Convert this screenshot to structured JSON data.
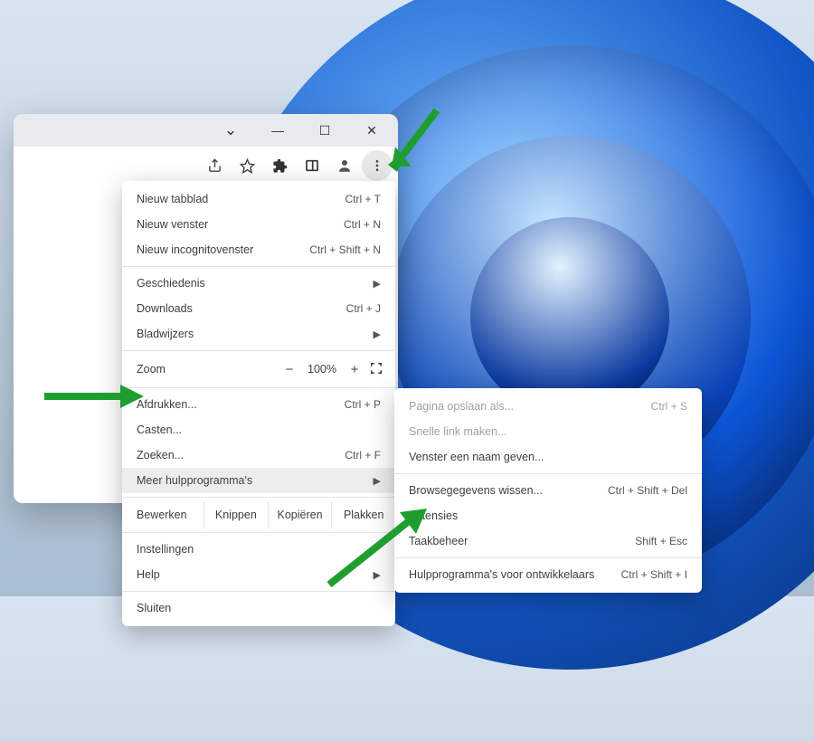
{
  "window_controls": {
    "tab_dropdown": "⌄",
    "minimize": "—",
    "maximize": "☐",
    "close": "✕"
  },
  "toolbar_icons": {
    "share": "share-icon",
    "bookmark": "star-icon",
    "extensions": "puzzle-icon",
    "sidepanel": "sidepanel-icon",
    "profile": "profile-icon",
    "menu": "three-dots-icon"
  },
  "menu": {
    "new_tab": {
      "label": "Nieuw tabblad",
      "shortcut": "Ctrl + T"
    },
    "new_window": {
      "label": "Nieuw venster",
      "shortcut": "Ctrl + N"
    },
    "new_incognito": {
      "label": "Nieuw incognitovenster",
      "shortcut": "Ctrl + Shift + N"
    },
    "history": {
      "label": "Geschiedenis"
    },
    "downloads": {
      "label": "Downloads",
      "shortcut": "Ctrl + J"
    },
    "bookmarks": {
      "label": "Bladwijzers"
    },
    "zoom_label": "Zoom",
    "zoom_value": "100%",
    "print": {
      "label": "Afdrukken...",
      "shortcut": "Ctrl + P"
    },
    "cast": {
      "label": "Casten..."
    },
    "find": {
      "label": "Zoeken...",
      "shortcut": "Ctrl + F"
    },
    "more_tools": {
      "label": "Meer hulpprogramma's"
    },
    "edit_label": "Bewerken",
    "edit_cut": "Knippen",
    "edit_copy": "Kopiëren",
    "edit_paste": "Plakken",
    "settings": {
      "label": "Instellingen"
    },
    "help": {
      "label": "Help"
    },
    "exit": {
      "label": "Sluiten"
    }
  },
  "submenu": {
    "save_as": {
      "label": "Pagina opslaan als...",
      "shortcut": "Ctrl + S"
    },
    "quick_link": {
      "label": "Snelle link maken..."
    },
    "name_window": {
      "label": "Venster een naam geven..."
    },
    "clear_data": {
      "label": "Browsegegevens wissen...",
      "shortcut": "Ctrl + Shift + Del"
    },
    "extensions": {
      "label": "Extensies"
    },
    "task_mgr": {
      "label": "Taakbeheer",
      "shortcut": "Shift + Esc"
    },
    "dev_tools": {
      "label": "Hulpprogramma's voor ontwikkelaars",
      "shortcut": "Ctrl + Shift + I"
    }
  },
  "annotation_color": "#1f9e2f"
}
